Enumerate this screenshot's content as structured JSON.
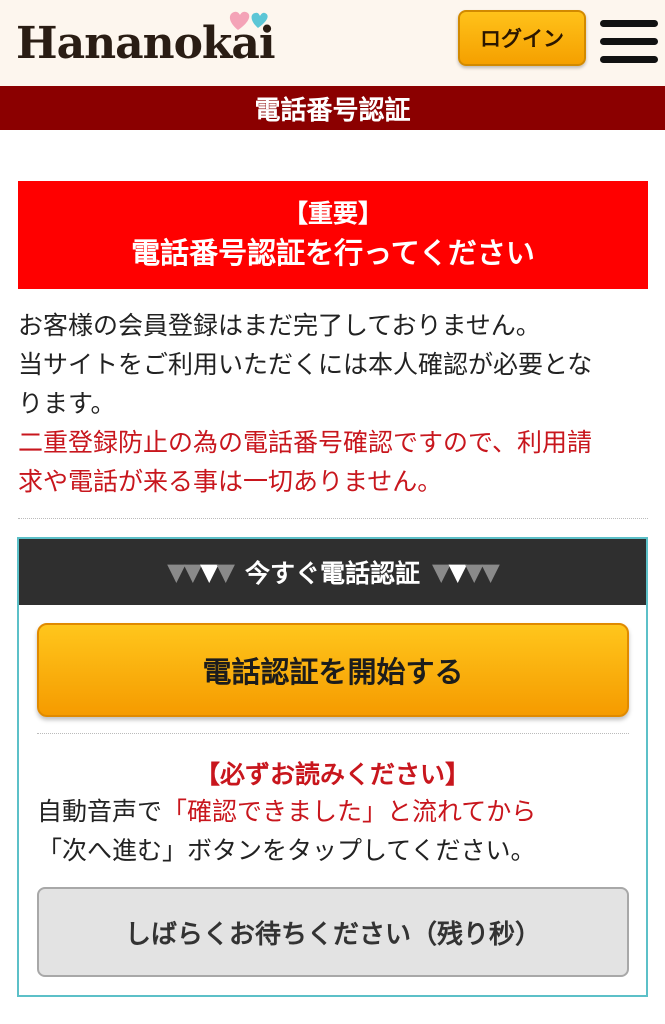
{
  "header": {
    "logo_text": "Hananokai",
    "login_label": "ログイン"
  },
  "title_bar": {
    "title": "電話番号認証"
  },
  "notice": {
    "line1": "【重要】",
    "line2": "電話番号認証を行ってください"
  },
  "info": {
    "line1": "お客様の会員登録はまだ完了しておりません。",
    "line2": "当サイトをご利用いただくには本人確認が必要とな",
    "line3": "ります。",
    "red_line1": "二重登録防止の為の電話番号確認ですので、利用請",
    "red_line2": "求や電話が来る事は一切ありません。"
  },
  "verify_box": {
    "heading": "今すぐ電話認証",
    "start_button": "電話認証を開始する",
    "must_read": "【必ずお読みください】",
    "instr_prefix": "自動音声で",
    "instr_red": "「確認できました」と流れてから",
    "instr_line2": "「次へ進む」ボタンをタップしてください。",
    "wait_button": "しばらくお待ちください（残り秒）"
  },
  "colors": {
    "title_bar_bg": "#8b0000",
    "notice_bg": "#ff0000",
    "accent_red_text": "#c8161d",
    "button_orange": "#f5a000",
    "box_border": "#5cc0c8",
    "box_header_bg": "#2f2f2f"
  },
  "icons": [
    "heart-icon",
    "menu-icon",
    "triangle-down-icon"
  ]
}
